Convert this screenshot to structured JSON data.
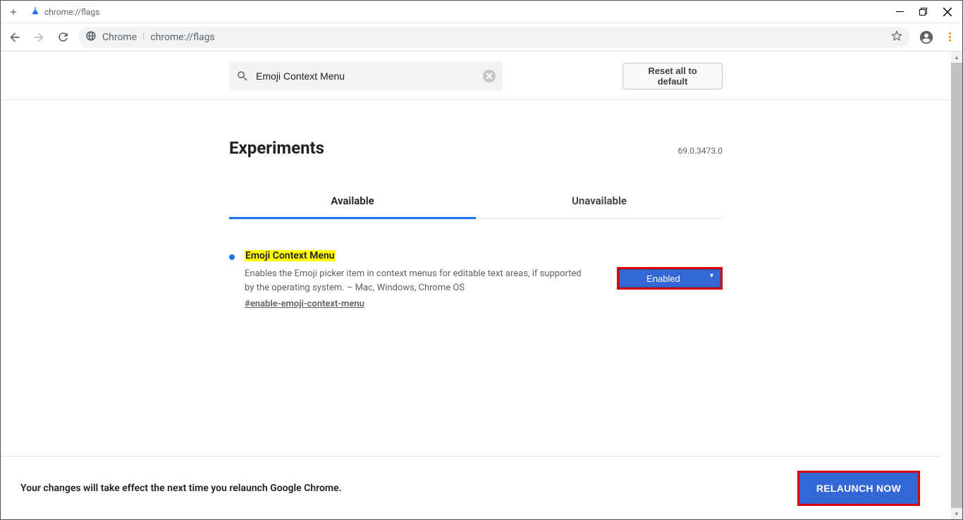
{
  "browser": {
    "tab_title": "chrome://flags",
    "omnibox_host": "Chrome",
    "omnibox_url": "chrome://flags"
  },
  "search": {
    "value": "Emoji Context Menu",
    "reset_label": "Reset all to default"
  },
  "header": {
    "title": "Experiments",
    "version": "69.0.3473.0"
  },
  "tabs": {
    "available": "Available",
    "unavailable": "Unavailable"
  },
  "flag": {
    "title": "Emoji Context Menu",
    "description": "Enables the Emoji picker item in context menus for editable text areas, if supported by the operating system. – Mac, Windows, Chrome OS",
    "anchor": "#enable-emoji-context-menu",
    "selected": "Enabled"
  },
  "relaunch": {
    "message": "Your changes will take effect the next time you relaunch Google Chrome.",
    "button": "RELAUNCH NOW"
  }
}
